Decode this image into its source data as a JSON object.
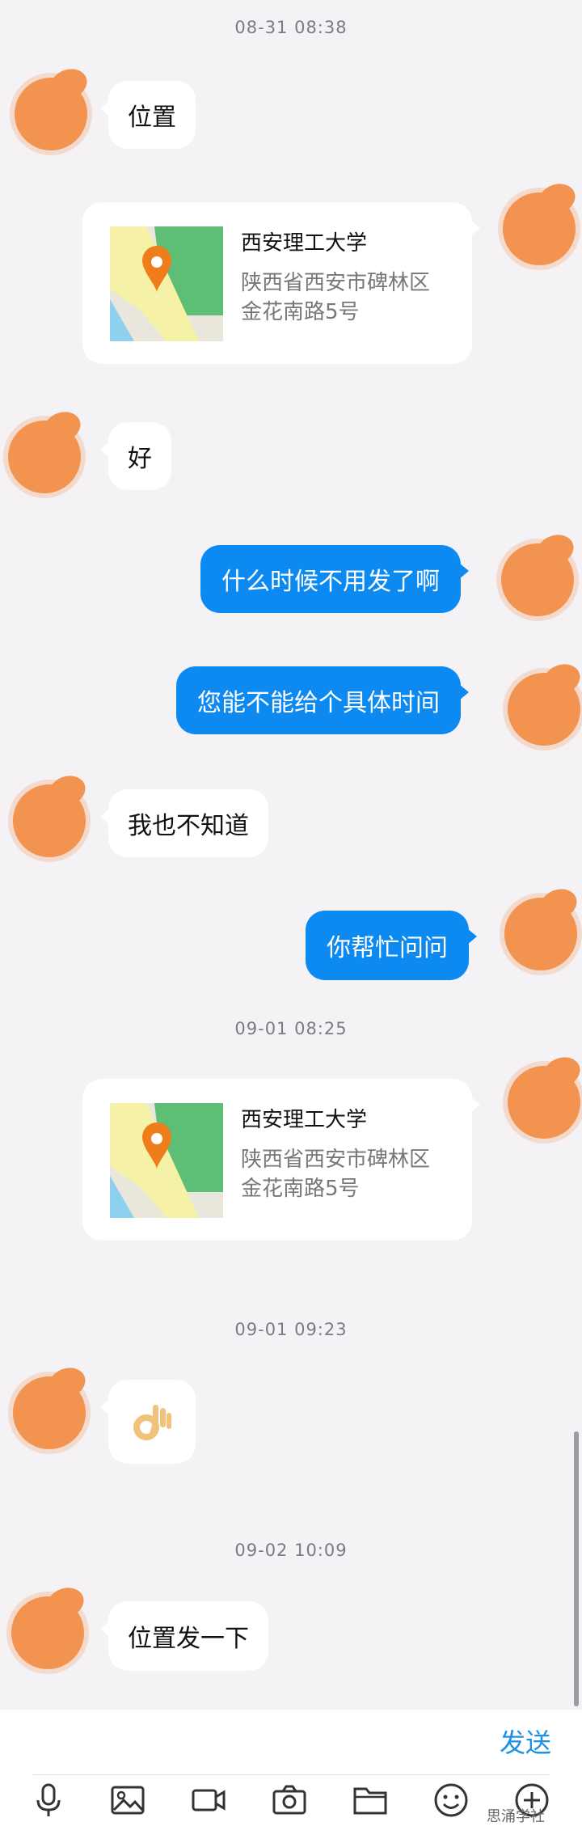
{
  "timestamps": [
    "08-31 08:38",
    "09-01 08:25",
    "09-01 09:23",
    "09-02 10:09"
  ],
  "messages": {
    "m1": "位置",
    "m3": "好",
    "m4": "什么时候不用发了啊",
    "m5": "您能不能给个具体时间",
    "m6": "我也不知道",
    "m7": "你帮忙问问",
    "m10": "位置发一下"
  },
  "location_card": {
    "name": "西安理工大学",
    "address_line1": "陕西省西安市碑林区",
    "address_line2": "金花南路5号"
  },
  "bottom_bar": {
    "send_label": "发送",
    "icons": [
      "microphone-icon",
      "image-icon",
      "video-icon",
      "camera-icon",
      "folder-icon",
      "emoji-icon",
      "plus-icon"
    ]
  },
  "watermark": "思涌学社",
  "colors": {
    "background": "#f5f2f6",
    "outgoing_bubble": "#0c8af2",
    "incoming_bubble": "#ffffff",
    "send_text": "#1c8fe6",
    "avatar_scribble": "#f39350"
  }
}
